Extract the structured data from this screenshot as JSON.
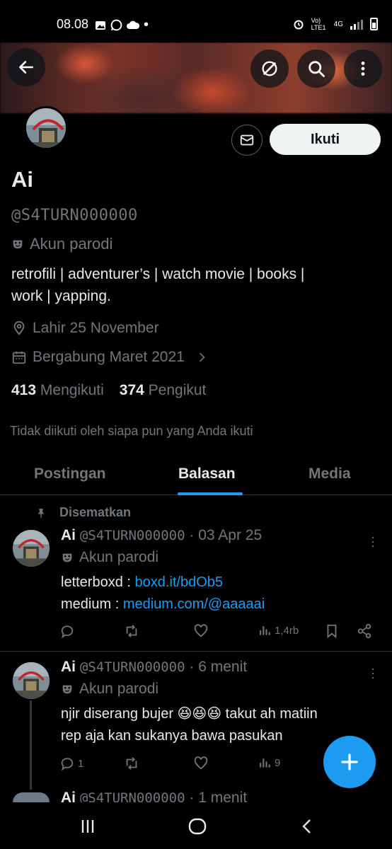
{
  "status_bar": {
    "time": "08.08",
    "network": "4G",
    "volte": "Vo) LTE1"
  },
  "profile": {
    "name": "Ai",
    "handle": "@S4TURN000000",
    "parody_label": "Akun parodi",
    "bio_line1": "retrofili | adventurer’s | watch movie | books |",
    "bio_line2": "work | yapping.",
    "birthday": "Lahir 25 November",
    "joined": "Bergabung Maret 2021",
    "following_count": "413",
    "following_label": "Mengikuti",
    "followers_count": "374",
    "followers_label": "Pengikut",
    "not_followed_note": "Tidak diikuti oleh siapa pun yang Anda ikuti",
    "follow_button": "Ikuti"
  },
  "tabs": [
    {
      "label": "Postingan",
      "active": false
    },
    {
      "label": "Balasan",
      "active": true
    },
    {
      "label": "Media",
      "active": false
    }
  ],
  "posts": [
    {
      "pinned_label": "Disematkan",
      "name": "Ai",
      "handle": "@S4TURN000000",
      "sep": "·",
      "time": "03 Apr 25",
      "parody_label": "Akun parodi",
      "line1_prefix": "letterboxd : ",
      "line1_link": "boxd.it/bdOb5",
      "line2_prefix": "medium : ",
      "line2_link": "medium.com/@aaaaai",
      "views": "1,4rb"
    },
    {
      "name": "Ai",
      "handle": "@S4TURN000000",
      "sep": "·",
      "time": "6 menit",
      "parody_label": "Akun parodi",
      "line1": "njir diserang bujer 😆😆😆 takut ah matiin",
      "line2": "rep aja  kan sukanya bawa pasukan",
      "replies": "1",
      "views": "9"
    },
    {
      "name": "Ai",
      "handle": "@S4TURN000000",
      "sep": "·",
      "time": "1 menit"
    }
  ]
}
